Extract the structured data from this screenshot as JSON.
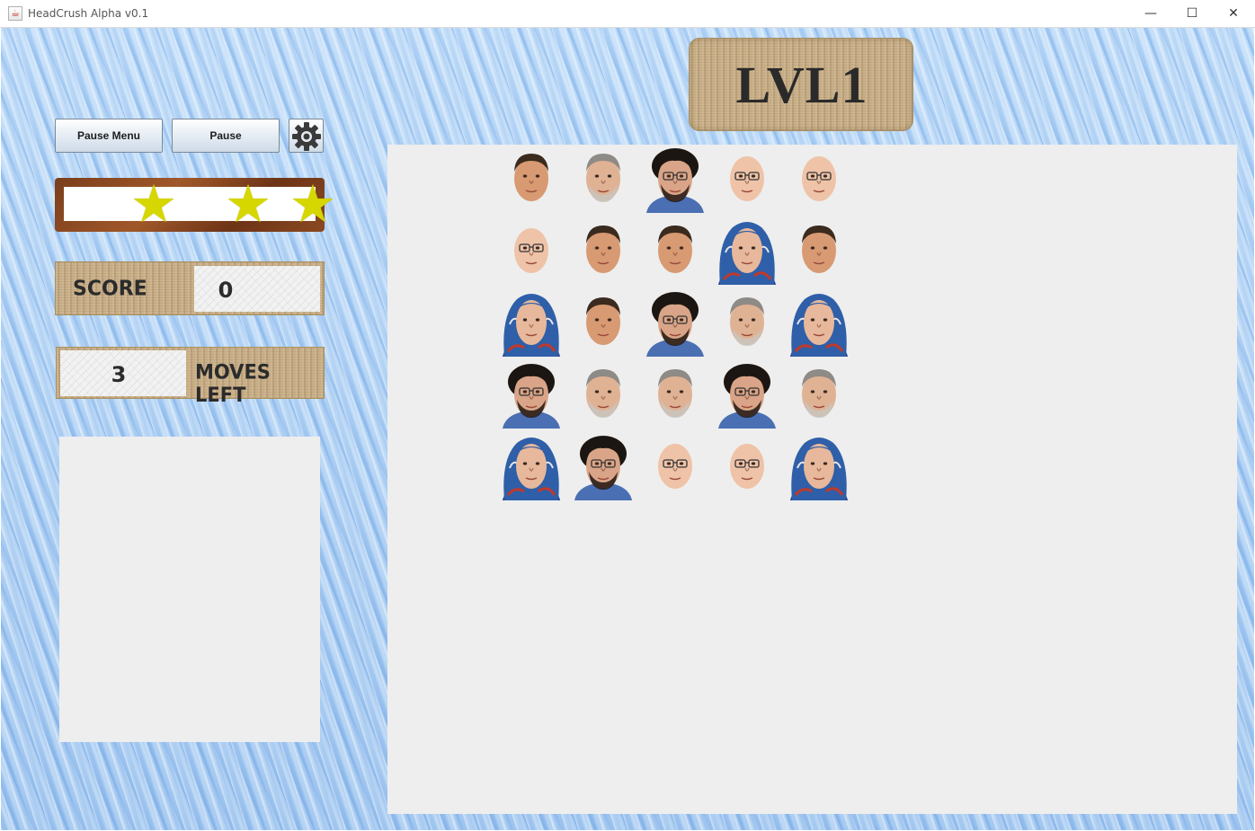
{
  "window": {
    "title": "HeadCrush Alpha v0.1",
    "controls": {
      "minimize": "—",
      "maximize": "☐",
      "close": "✕"
    }
  },
  "toolbar": {
    "pause_menu_label": "Pause Menu",
    "pause_label": "Pause"
  },
  "stars": {
    "count": 3,
    "filled": 3,
    "glyph": "★",
    "color": "#d6d600"
  },
  "score": {
    "label": "SCORE",
    "value": "0"
  },
  "moves": {
    "label": "MOVES LEFT",
    "value": "3"
  },
  "level": {
    "label": "LVL1"
  },
  "board": {
    "rows": 5,
    "cols": 5,
    "grid": [
      [
        "tanned-man",
        "gray-haired-man",
        "bearded-man",
        "bald-man",
        "bald-man"
      ],
      [
        "bald-man",
        "tanned-man",
        "tanned-man",
        "headscarf-woman",
        "tanned-man"
      ],
      [
        "headscarf-woman",
        "tanned-man",
        "bearded-man",
        "gray-haired-man",
        "headscarf-woman"
      ],
      [
        "bearded-man",
        "gray-haired-man",
        "gray-haired-man",
        "bearded-man",
        "gray-haired-man"
      ],
      [
        "headscarf-woman",
        "bearded-man",
        "bald-man",
        "bald-man",
        "headscarf-woman"
      ]
    ]
  }
}
